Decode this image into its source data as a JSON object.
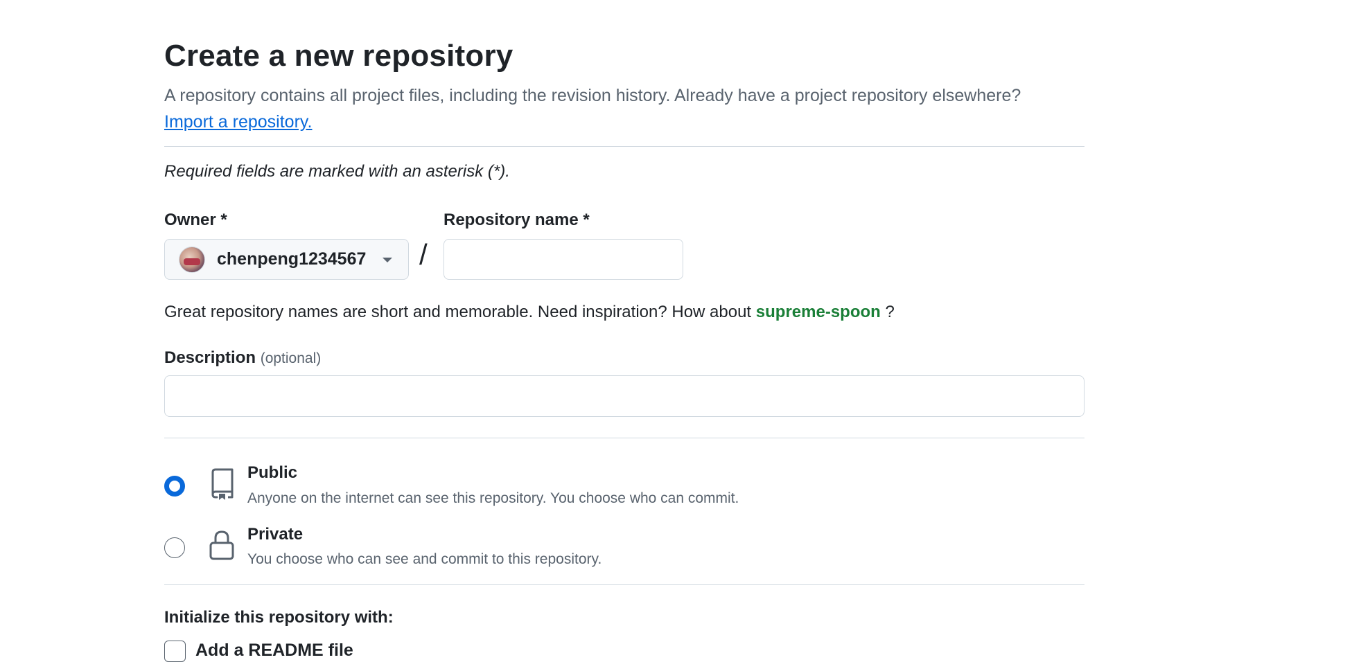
{
  "page": {
    "title": "Create a new repository",
    "subtitle": "A repository contains all project files, including the revision history. Already have a project repository elsewhere?",
    "import_link": "Import a repository.",
    "required_note": "Required fields are marked with an asterisk (*)."
  },
  "owner": {
    "label": "Owner *",
    "selected": "chenpeng1234567"
  },
  "separator": "/",
  "repo_name": {
    "label": "Repository name *",
    "value": "",
    "placeholder": ""
  },
  "hint": {
    "text": "Great repository names are short and memorable. Need inspiration? How about",
    "suggestion": "supreme-spoon",
    "suffix": "?"
  },
  "description": {
    "label": "Description",
    "optional": "(optional)",
    "value": "",
    "placeholder": ""
  },
  "visibility": {
    "selected": "public",
    "options": [
      {
        "id": "public",
        "title": "Public",
        "description": "Anyone on the internet can see this repository. You choose who can commit.",
        "icon": "repo-icon"
      },
      {
        "id": "private",
        "title": "Private",
        "description": "You choose who can see and commit to this repository.",
        "icon": "lock-icon"
      }
    ]
  },
  "initialize": {
    "title": "Initialize this repository with:",
    "readme_label": "Add a README file",
    "readme_checked": false
  },
  "colors": {
    "link": "#0969da",
    "suggestion": "#1a7f37",
    "muted": "#59636e",
    "border": "#d1d9e0"
  }
}
